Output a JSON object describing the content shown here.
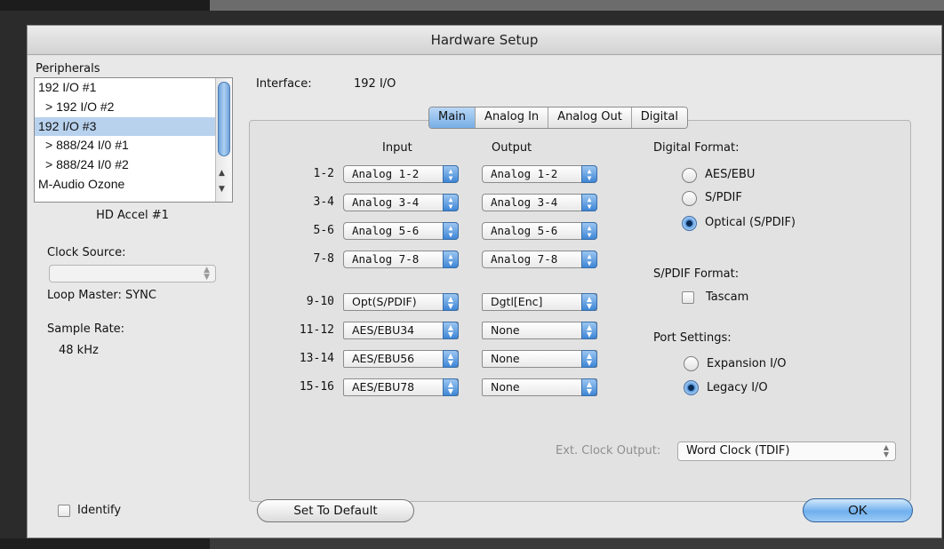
{
  "window": {
    "title": "Hardware Setup"
  },
  "left": {
    "peripherals_label": "Peripherals",
    "peripherals": [
      {
        "label": "192 I/O #1",
        "indent": false,
        "selected": false
      },
      {
        "label": "> 192 I/O #2",
        "indent": true,
        "selected": false
      },
      {
        "label": "192 I/O #3",
        "indent": false,
        "selected": true
      },
      {
        "label": "> 888/24 I/0 #1",
        "indent": true,
        "selected": false
      },
      {
        "label": "> 888/24 I/0 #2",
        "indent": true,
        "selected": false
      },
      {
        "label": "M-Audio Ozone",
        "indent": false,
        "selected": false
      }
    ],
    "card_label": "HD Accel #1",
    "clock_source_label": "Clock Source:",
    "clock_source_value": "",
    "loop_master": "Loop Master: SYNC",
    "sample_rate_label": "Sample Rate:",
    "sample_rate_value": "48 kHz",
    "identify_label": "Identify",
    "identify_checked": false
  },
  "interface": {
    "label": "Interface:",
    "value": "192 I/O"
  },
  "tabs": [
    {
      "label": "Main",
      "active": true
    },
    {
      "label": "Analog In",
      "active": false
    },
    {
      "label": "Analog Out",
      "active": false
    },
    {
      "label": "Digital",
      "active": false
    }
  ],
  "io": {
    "input_header": "Input",
    "output_header": "Output",
    "rows": [
      {
        "label": "1-2",
        "input": "Analog 1-2",
        "output": "Analog 1-2"
      },
      {
        "label": "3-4",
        "input": "Analog 3-4",
        "output": "Analog 3-4"
      },
      {
        "label": "5-6",
        "input": "Analog 5-6",
        "output": "Analog 5-6"
      },
      {
        "label": "7-8",
        "input": "Analog 7-8",
        "output": "Analog 7-8"
      },
      {
        "label": "9-10",
        "input": "Opt(S/PDIF)",
        "output": "Dgtl[Enc]"
      },
      {
        "label": "11-12",
        "input": "AES/EBU34",
        "output": "None"
      },
      {
        "label": "13-14",
        "input": "AES/EBU56",
        "output": "None"
      },
      {
        "label": "15-16",
        "input": "AES/EBU78",
        "output": "None"
      }
    ]
  },
  "digital_format": {
    "label": "Digital Format:",
    "options": [
      "AES/EBU",
      "S/PDIF",
      "Optical (S/PDIF)"
    ],
    "selected": "Optical (S/PDIF)"
  },
  "spdif_format": {
    "label": "S/PDIF Format:",
    "tascam_label": "Tascam",
    "tascam_checked": false
  },
  "port_settings": {
    "label": "Port Settings:",
    "options": [
      "Expansion I/O",
      "Legacy I/O"
    ],
    "selected": "Legacy I/O"
  },
  "ext_clock": {
    "label": "Ext. Clock Output:",
    "value": "Word Clock (TDIF)"
  },
  "buttons": {
    "set_default": "Set To Default",
    "ok": "OK"
  },
  "colors": {
    "accent": "#5c9ce0",
    "selection": "#b8d2ee",
    "window_bg": "#e8e8e8"
  }
}
